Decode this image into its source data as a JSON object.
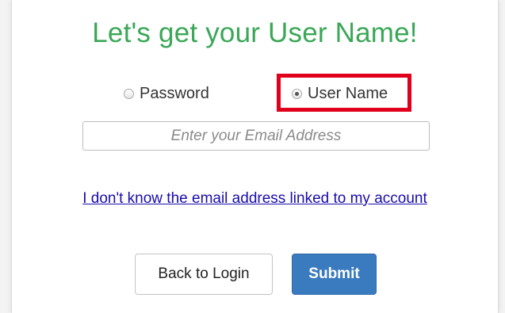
{
  "title": "Let's get your User Name!",
  "options": {
    "password": {
      "label": "Password",
      "selected": false
    },
    "username": {
      "label": "User Name",
      "selected": true
    }
  },
  "email": {
    "value": "",
    "placeholder": "Enter your Email Address"
  },
  "help_link": "I don't know the email address linked to my account",
  "buttons": {
    "back": "Back to Login",
    "submit": "Submit"
  },
  "colors": {
    "title": "#3aa757",
    "highlight": "#e0001b",
    "submit": "#3a7bbf",
    "link": "#1a0dab"
  }
}
